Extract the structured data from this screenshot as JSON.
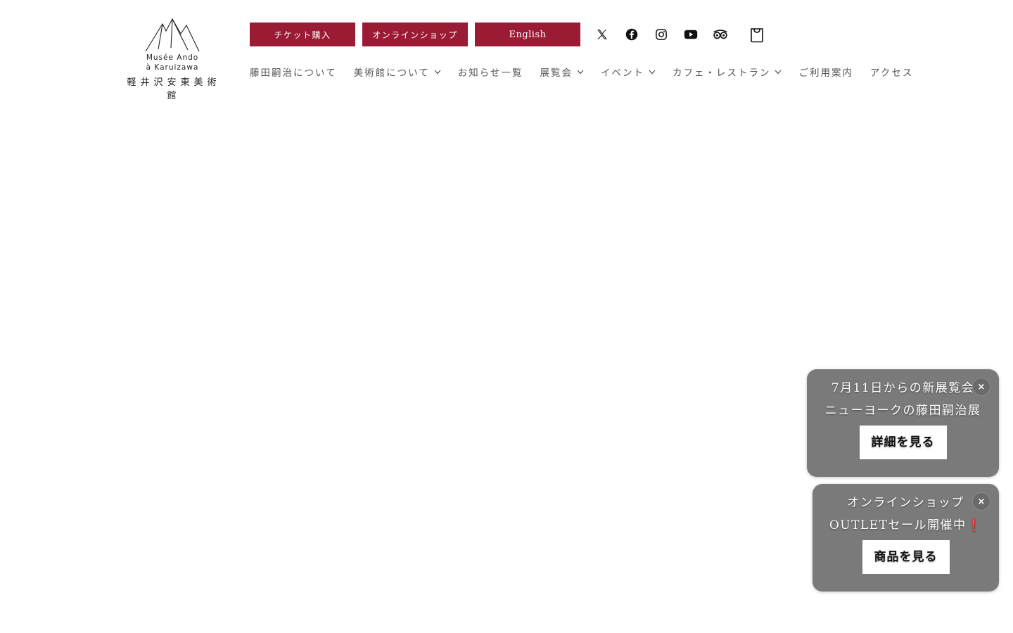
{
  "brand": {
    "name_en_line1": "Musée Ando",
    "name_en_line2": "à Karuizawa",
    "name_jp": "軽井沢安東美術館"
  },
  "top_buttons": {
    "tickets": "チケット購入",
    "shop": "オンラインショップ",
    "english": "English"
  },
  "social": [
    "x-icon",
    "facebook-icon",
    "instagram-icon",
    "youtube-icon",
    "tripadvisor-icon",
    "cart-icon"
  ],
  "nav": [
    {
      "label": "藤田嗣治について",
      "dropdown": false
    },
    {
      "label": "美術館について",
      "dropdown": true
    },
    {
      "label": "お知らせ一覧",
      "dropdown": false
    },
    {
      "label": "展覧会",
      "dropdown": true
    },
    {
      "label": "イベント",
      "dropdown": true
    },
    {
      "label": "カフェ・レストラン",
      "dropdown": true
    },
    {
      "label": "ご利用案内",
      "dropdown": false
    },
    {
      "label": "アクセス",
      "dropdown": false
    }
  ],
  "popups": [
    {
      "line1": "7月11日からの新展覧会",
      "line2": "ニューヨークの藤田嗣治展",
      "button": "詳細を見る",
      "close": "×"
    },
    {
      "line1": "オンラインショップ",
      "line2": "OUTLETセール開催中❗",
      "button": "商品を見る",
      "close": "×"
    }
  ],
  "colors": {
    "accent": "#9b1b35",
    "popup_bg": "#7a7a7a"
  }
}
